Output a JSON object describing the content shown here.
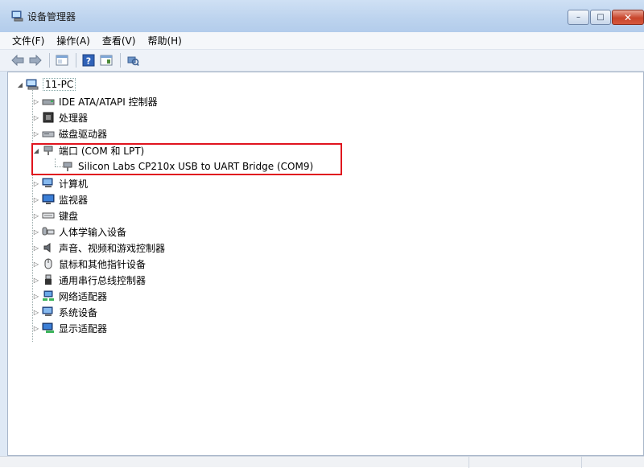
{
  "window": {
    "title": "设备管理器",
    "controls": {
      "minimize": "–",
      "maximize": "□",
      "close": "✕"
    }
  },
  "menu": {
    "items": [
      "文件(F)",
      "操作(A)",
      "查看(V)",
      "帮助(H)"
    ]
  },
  "toolbar": {
    "buttons": [
      "back-arrow-icon",
      "forward-arrow-icon",
      "properties-icon",
      "help-icon",
      "show-hidden-icon",
      "scan-hardware-icon"
    ]
  },
  "tree": {
    "root": "11-PC",
    "items": [
      {
        "label": "IDE ATA/ATAPI 控制器",
        "icon": "ide-controller-icon",
        "expanded": false
      },
      {
        "label": "处理器",
        "icon": "processor-icon",
        "expanded": false
      },
      {
        "label": "磁盘驱动器",
        "icon": "disk-drive-icon",
        "expanded": false
      },
      {
        "label": "端口 (COM 和 LPT)",
        "icon": "port-icon",
        "expanded": true,
        "children": [
          {
            "label": "Silicon Labs CP210x USB to UART Bridge (COM9)",
            "icon": "port-icon"
          }
        ]
      },
      {
        "label": "计算机",
        "icon": "computer-icon",
        "expanded": false
      },
      {
        "label": "监视器",
        "icon": "monitor-icon",
        "expanded": false
      },
      {
        "label": "键盘",
        "icon": "keyboard-icon",
        "expanded": false
      },
      {
        "label": "人体学输入设备",
        "icon": "hid-icon",
        "expanded": false
      },
      {
        "label": "声音、视频和游戏控制器",
        "icon": "speaker-icon",
        "expanded": false
      },
      {
        "label": "鼠标和其他指针设备",
        "icon": "mouse-icon",
        "expanded": false
      },
      {
        "label": "通用串行总线控制器",
        "icon": "usb-icon",
        "expanded": false
      },
      {
        "label": "网络适配器",
        "icon": "network-icon",
        "expanded": false
      },
      {
        "label": "系统设备",
        "icon": "system-device-icon",
        "expanded": false
      },
      {
        "label": "显示适配器",
        "icon": "display-adapter-icon",
        "expanded": false
      }
    ]
  },
  "colors": {
    "highlight_box": "#e0141e",
    "accent": "#3a6fb0"
  }
}
